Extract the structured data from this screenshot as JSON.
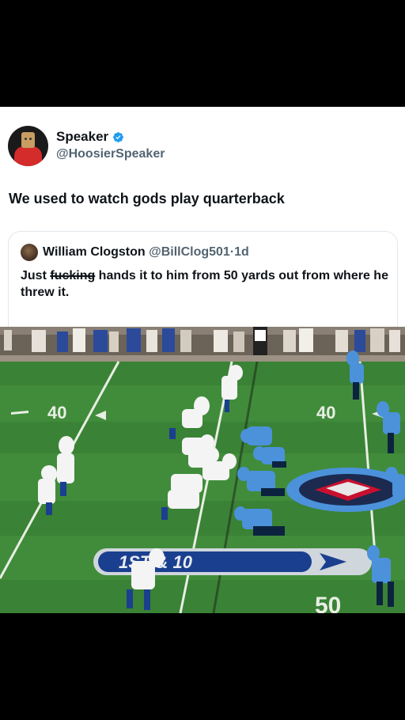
{
  "post": {
    "display_name": "Speaker",
    "handle": "@HoosierSpeaker",
    "text": "We used to watch gods play quarterback",
    "verified": true
  },
  "quote": {
    "author_name": "William Clogston",
    "author_handle": "@BillClog501",
    "separator": "·",
    "time": "1d",
    "text_before": "Just ",
    "text_struck": "fucking",
    "text_after": " hands it to him from 50 yards out from where he threw it."
  },
  "video": {
    "down_distance": "1ST & 10",
    "field_numbers": [
      "40",
      "40",
      "50"
    ]
  },
  "colors": {
    "verified_blue": "#1d9bf0",
    "field_green": "#3f8a3a",
    "colts_blue": "#1b3f8f",
    "titans_light_blue": "#4b92db"
  }
}
